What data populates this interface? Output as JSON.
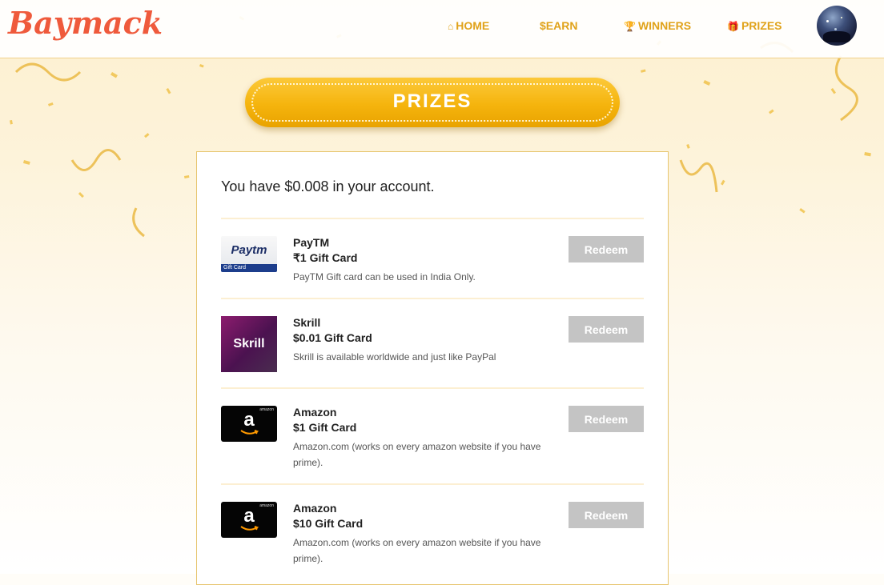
{
  "brand": {
    "logo_text": "Baymack",
    "accent_color": "#ef5a3c",
    "nav_color": "#e0a21a"
  },
  "nav": {
    "items": [
      {
        "icon": "home-icon",
        "glyph": "⌂",
        "label": "HOME"
      },
      {
        "icon": "dollar-icon",
        "glyph": "$",
        "label": "EARN"
      },
      {
        "icon": "trophy-icon",
        "glyph": "🏆",
        "label": "WINNERS"
      },
      {
        "icon": "gift-icon",
        "glyph": "🎁",
        "label": "PRIZES"
      }
    ]
  },
  "page": {
    "title": "PRIZES",
    "balance_text": "You have $0.008 in your account."
  },
  "prizes": [
    {
      "name": "PayTM",
      "value": "₹1 Gift Card",
      "description": "PayTM Gift card can be used in India Only.",
      "image": "paytm-logo",
      "image_text": "Paytm",
      "image_caption": "Gift Card",
      "button": "Redeem"
    },
    {
      "name": "Skrill",
      "value": "$0.01 Gift Card",
      "description": "Skrill is available worldwide and just like PayPal",
      "image": "skrill-logo",
      "image_text": "Skrill",
      "button": "Redeem"
    },
    {
      "name": "Amazon",
      "value": "$1 Gift Card",
      "description": "Amazon.com (works on every amazon website if you have prime).",
      "image": "amazon-logo",
      "image_text": "a",
      "image_caption": "amazon",
      "button": "Redeem"
    },
    {
      "name": "Amazon",
      "value": "$10 Gift Card",
      "description": "Amazon.com (works on every amazon website if you have prime).",
      "image": "amazon-logo",
      "image_text": "a",
      "image_caption": "amazon",
      "button": "Redeem"
    }
  ],
  "colors": {
    "banner": "#f5b40d",
    "redeem_disabled": "#c4c4c4",
    "card_border": "#e7c56f"
  }
}
